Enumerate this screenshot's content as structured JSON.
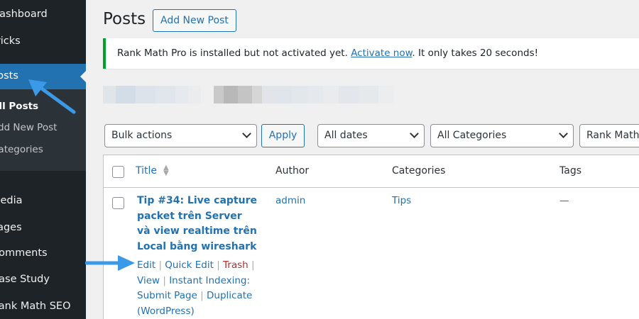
{
  "sidebar": {
    "items": [
      {
        "label": "Dashboard"
      },
      {
        "label": "Tricks"
      },
      {
        "label": "Posts"
      },
      {
        "label": "Media"
      },
      {
        "label": "Pages"
      },
      {
        "label": "Comments"
      },
      {
        "label": "Case Study"
      },
      {
        "label": "Rank Math SEO"
      }
    ],
    "submenu": [
      {
        "label": "All Posts"
      },
      {
        "label": "Add New Post"
      },
      {
        "label": "Categories"
      }
    ]
  },
  "header": {
    "title": "Posts",
    "add_new_label": "Add New Post"
  },
  "notice": {
    "text_before": "Rank Math Pro is installed but not activated yet. ",
    "link": "Activate now",
    "text_after": ". It only takes 20 seconds!"
  },
  "filters": {
    "bulk_actions": "Bulk actions",
    "apply_label": "Apply",
    "dates": "All dates",
    "categories": "All Categories",
    "rank_math": "Rank Math"
  },
  "table": {
    "columns": {
      "title": "Title",
      "author": "Author",
      "categories": "Categories",
      "tags": "Tags"
    },
    "rows": [
      {
        "title": "Tip #34: Live capture packet trên Server và view realtime trên Local bằng wireshark",
        "author": "admin",
        "category": "Tips",
        "tags": "—",
        "actions": {
          "edit": "Edit",
          "quick_edit": "Quick Edit",
          "trash": "Trash",
          "view": "View",
          "instant_indexing": "Instant Indexing: Submit Page",
          "duplicate": "Duplicate (WordPress)"
        }
      }
    ]
  },
  "colors": {
    "sidebar_bg": "#1d2327",
    "accent": "#2271b1",
    "success": "#00a32a",
    "danger": "#b32d2e",
    "annotation_arrow": "#3b9ae8"
  }
}
